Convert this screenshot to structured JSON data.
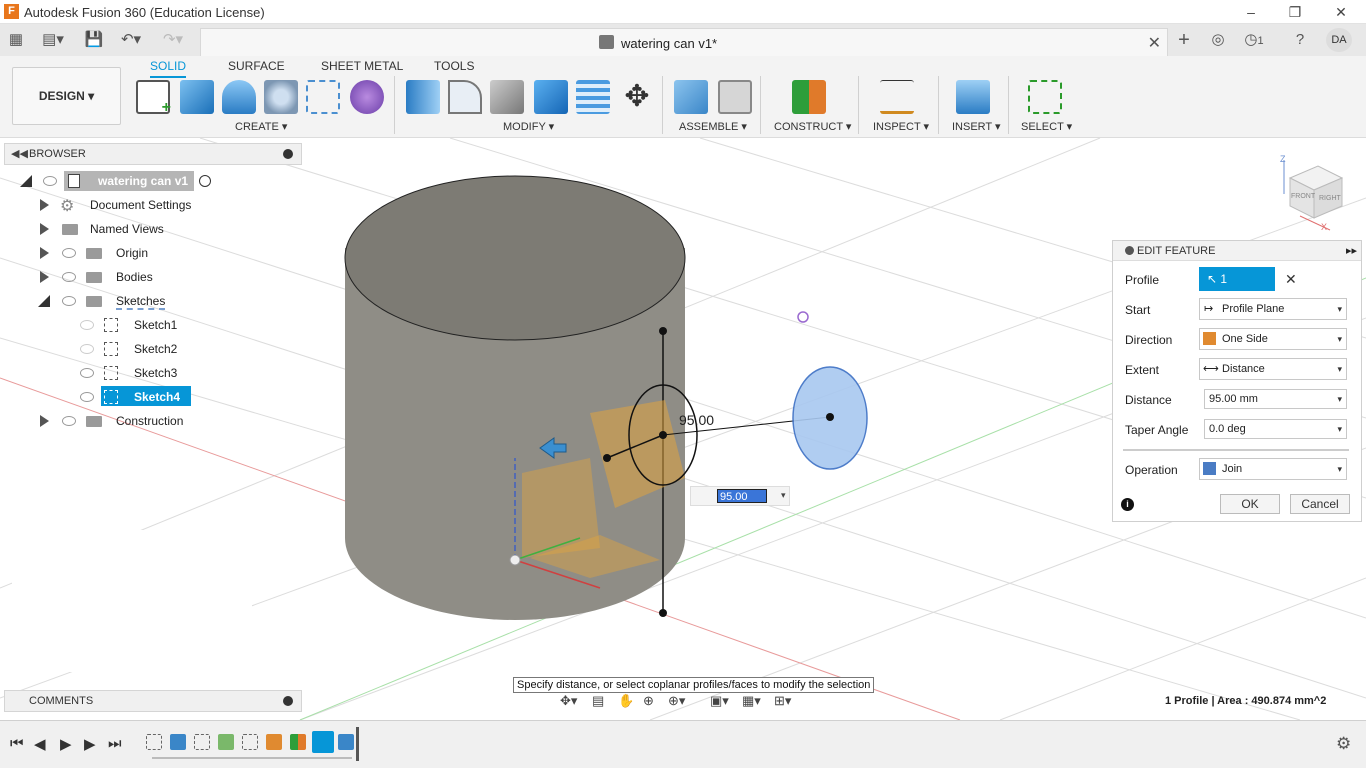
{
  "app": {
    "title": "Autodesk Fusion 360 (Education License)"
  },
  "tab": {
    "doc_name": "watering can v1*",
    "notif_count": "1",
    "user_initials": "DA"
  },
  "ribbon": {
    "tabs": [
      "SOLID",
      "SURFACE",
      "SHEET METAL",
      "TOOLS"
    ],
    "workspace": "DESIGN",
    "groups": [
      "CREATE",
      "MODIFY",
      "ASSEMBLE",
      "CONSTRUCT",
      "INSPECT",
      "INSERT",
      "SELECT"
    ]
  },
  "browser": {
    "title": "BROWSER",
    "root": "watering can v1",
    "items": [
      "Document Settings",
      "Named Views",
      "Origin",
      "Bodies",
      "Sketches"
    ],
    "sketches": [
      "Sketch1",
      "Sketch2",
      "Sketch3",
      "Sketch4"
    ],
    "construction": "Construction"
  },
  "feature": {
    "title": "EDIT FEATURE",
    "profile_label": "Profile",
    "profile_value": "1 selected",
    "start_label": "Start",
    "start_value": "Profile Plane",
    "direction_label": "Direction",
    "direction_value": "One Side",
    "extent_label": "Extent",
    "extent_value": "Distance",
    "distance_label": "Distance",
    "distance_value": "95.00 mm",
    "taper_label": "Taper Angle",
    "taper_value": "0.0 deg",
    "operation_label": "Operation",
    "operation_value": "Join",
    "ok": "OK",
    "cancel": "Cancel"
  },
  "canvas": {
    "dim_label": "95.00",
    "dim_input": "95.00 mm",
    "hint": "Specify distance, or select coplanar profiles/faces to modify the selection",
    "viewcube_front": "FRONT",
    "viewcube_right": "RIGHT",
    "axis_z": "Z",
    "axis_x": "X"
  },
  "comments": {
    "title": "COMMENTS"
  },
  "status": {
    "text": "1 Profile | Area : 490.874 mm^2"
  },
  "colors": {
    "accent": "#0696d7",
    "body": "#8f8d86",
    "selection": "#a8c8f0"
  }
}
